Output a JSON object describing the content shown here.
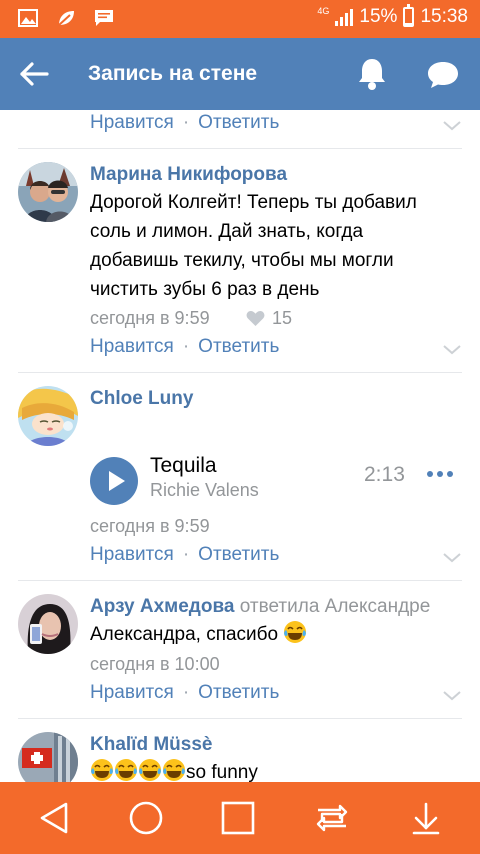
{
  "status_bar": {
    "network": "4G",
    "battery": "15%",
    "battery_level": 0.15,
    "time": "15:38",
    "color": "#f36a2b",
    "icons": [
      "gallery-icon",
      "leaf-app-icon",
      "message-icon"
    ]
  },
  "header": {
    "title": "Запись на стене",
    "color": "#5181b8",
    "icons": [
      "back-arrow-icon",
      "bell-icon",
      "chat-bubble-icon"
    ]
  },
  "actions": {
    "like": "Нравится",
    "sep": "·",
    "reply": "Ответить"
  },
  "comments": [
    {
      "author": "Марина Никифорова",
      "text_lines": [
        "Дорогой Колгейт! Теперь ты добавил",
        "соль и лимон. Дай знать, когда",
        "добавишь текилу, чтобы мы могли",
        "чистить зубы 6 раз в день"
      ],
      "time": "сегодня в 9:59",
      "likes": "15"
    },
    {
      "author": "Chloe Luny",
      "audio": {
        "title": "Tequila",
        "artist": "Richie Valens",
        "duration": "2:13"
      },
      "time": "сегодня в 9:59"
    },
    {
      "author": "Арзу Ахмедова",
      "replied": "ответила Александре",
      "text": "Александра, спасибо",
      "emoji": "face-with-tears-of-joy",
      "time": "сегодня в 10:00"
    },
    {
      "author": "Khalïd Müssè",
      "emoji_count": 4,
      "text": "so funny"
    }
  ],
  "nav_bar": {
    "color": "#f36a2b",
    "icons": [
      "back-triangle-icon",
      "home-circle-icon",
      "recents-square-icon",
      "switch-icon",
      "download-icon"
    ]
  }
}
